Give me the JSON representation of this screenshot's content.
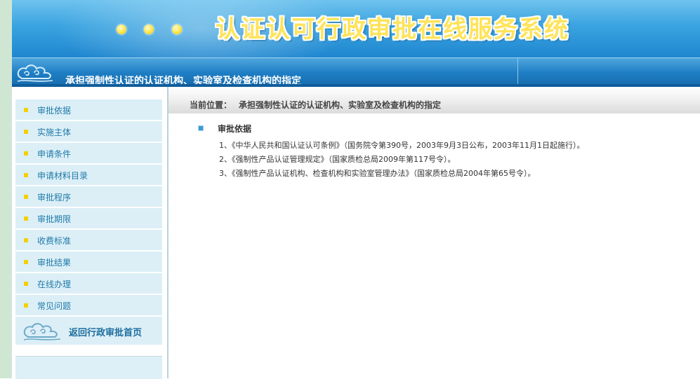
{
  "banner": {
    "title": "认证认可行政审批在线服务系统"
  },
  "nav": {
    "title": "承担强制性认证的认证机构、实验室及检查机构的指定"
  },
  "sidebar": {
    "items": [
      {
        "label": "审批依据"
      },
      {
        "label": "实施主体"
      },
      {
        "label": "申请条件"
      },
      {
        "label": "申请材料目录"
      },
      {
        "label": "审批程序"
      },
      {
        "label": "审批期限"
      },
      {
        "label": "收费标准"
      },
      {
        "label": "审批结果"
      },
      {
        "label": "在线办理"
      },
      {
        "label": "常见问题"
      }
    ],
    "back_label": "返回行政审批首页"
  },
  "breadcrumb": {
    "prefix": "当前位置：",
    "value": "承担强制性认证的认证机构、实验室及检查机构的指定"
  },
  "content": {
    "section_title": "审批依据",
    "items": [
      "1、《中华人民共和国认证认可条例》（国务院令第390号，2003年9月3日公布，2003年11月1日起施行）。",
      "2、《强制性产品认证管理规定》（国家质检总局2009年第117号令）。",
      "3、《强制性产品认证机构、检查机构和实验室管理办法》（国家质检总局2004年第65号令）。"
    ]
  },
  "colors": {
    "banner_blue": "#2f97da",
    "title_yellow": "#ffe35a",
    "sidebar_bg": "#dceff7",
    "bullet_yellow": "#f3d000",
    "link_blue": "#1f7aa8"
  },
  "icons": {
    "nav_decoration": "cloud-swirl-icon",
    "back_decoration": "cloud-swirl-icon",
    "item_bullet": "square-bullet-icon"
  }
}
